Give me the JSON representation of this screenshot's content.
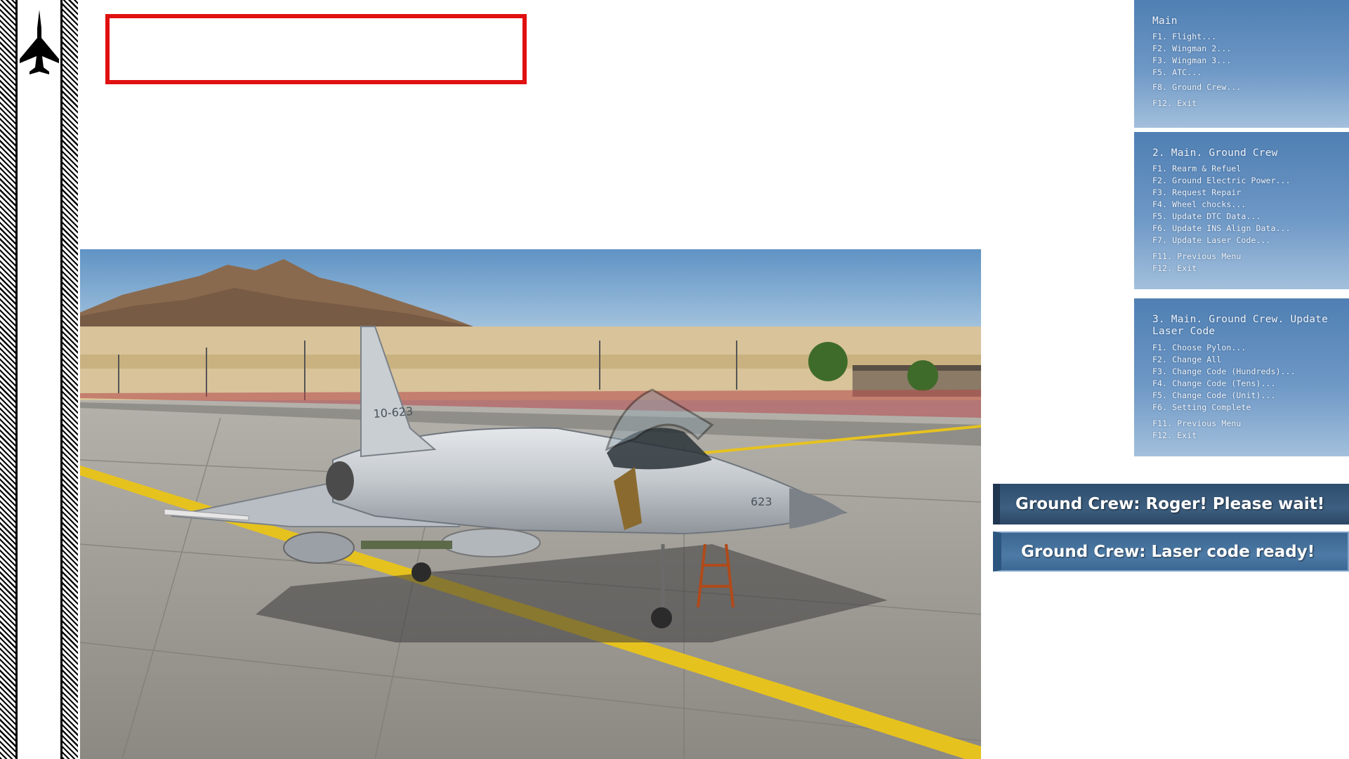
{
  "menus": {
    "main": {
      "title": "Main",
      "items": [
        "F1. Flight...",
        "F2. Wingman 2...",
        "F3. Wingman 3...",
        "F5. ATC...",
        "F8. Ground Crew...",
        "F12. Exit"
      ]
    },
    "ground_crew": {
      "title": "2. Main. Ground Crew",
      "items": [
        "F1. Rearm & Refuel",
        "F2. Ground Electric Power...",
        "F3. Request Repair",
        "F4. Wheel chocks...",
        "F5. Update DTC Data...",
        "F6. Update INS Align Data...",
        "F7. Update Laser Code..."
      ],
      "footer": [
        "F11. Previous Menu",
        "F12. Exit"
      ]
    },
    "laser_code": {
      "title": "3. Main. Ground Crew. Update Laser Code",
      "items": [
        "F1. Choose Pylon...",
        "F2. Change All",
        "F3. Change Code (Hundreds)...",
        "F4. Change Code (Tens)...",
        "F5. Change Code (Unit)...",
        "F6. Setting Complete"
      ],
      "footer": [
        "F11. Previous Menu",
        "F12. Exit"
      ]
    }
  },
  "messages": {
    "roger": "Ground Crew: Roger! Please wait!",
    "ready": "Ground Crew: Laser code ready!"
  },
  "aircraft": {
    "tail_code": "10-623",
    "nose_number": "623"
  },
  "colors": {
    "frame_red": "#e01010",
    "menu_blue": "#5f8cbf",
    "message_bg": "#34557a"
  }
}
